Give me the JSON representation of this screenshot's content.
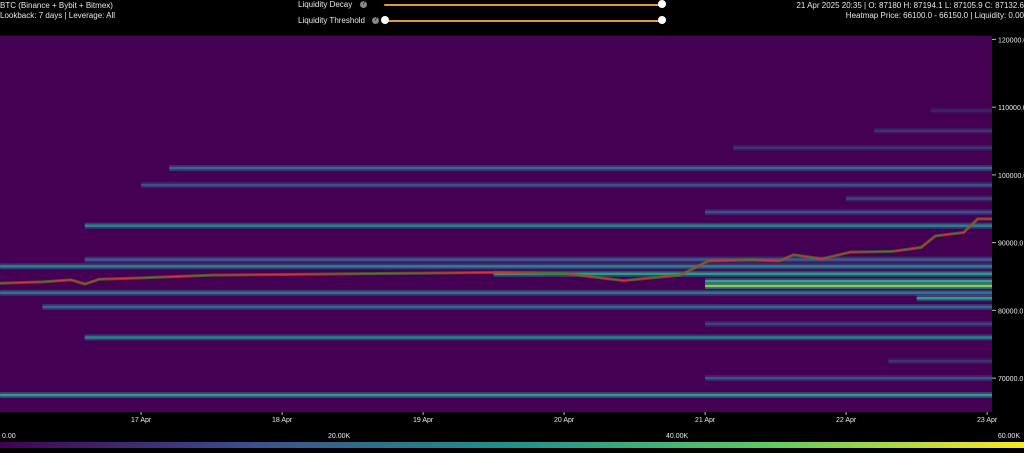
{
  "header": {
    "title": "BTC (Binance + Bybit + Bitmex)",
    "subtitle": "Lookback: 7 days | Leverage: All",
    "ohlc": "21 Apr 2025 20:35 | O: 87180 H: 87194.1 L: 87105.9 C: 87132.6",
    "heatmap_info": "Heatmap Price: 66100.0 - 66150.0 | Liquidity: 0.00",
    "sliders": [
      {
        "label": "Liquidity Decay",
        "help": "?",
        "value": 1.0
      },
      {
        "label": "Liquidity Threshold",
        "help": "?",
        "value": 0.0
      }
    ]
  },
  "colors": {
    "background": "#440154",
    "price_line": "#d4342c",
    "slider_track": "#e8963a"
  },
  "chart_data": {
    "type": "heatmap",
    "x_ticks": [
      "17 Apr",
      "18 Apr",
      "19 Apr",
      "20 Apr",
      "21 Apr",
      "22 Apr",
      "23 Apr"
    ],
    "y_ticks": [
      "120000.0",
      "110000.0",
      "100000.0",
      "90000.0",
      "80000.0",
      "70000.0"
    ],
    "ylim": [
      65000,
      120500
    ],
    "price_line": [
      [
        0,
        84000
      ],
      [
        0.3,
        84200
      ],
      [
        0.5,
        84500
      ],
      [
        0.6,
        83900
      ],
      [
        0.7,
        84600
      ],
      [
        1.0,
        84800
      ],
      [
        1.5,
        85200
      ],
      [
        2.0,
        85300
      ],
      [
        2.5,
        85400
      ],
      [
        3.0,
        85500
      ],
      [
        3.5,
        85600
      ],
      [
        4.0,
        85400
      ],
      [
        4.4,
        84400
      ],
      [
        4.8,
        85200
      ],
      [
        5.0,
        87300
      ],
      [
        5.3,
        87500
      ],
      [
        5.5,
        87300
      ],
      [
        5.6,
        88200
      ],
      [
        5.8,
        87600
      ],
      [
        6.0,
        88600
      ],
      [
        6.3,
        88700
      ],
      [
        6.5,
        89300
      ],
      [
        6.6,
        91000
      ],
      [
        6.8,
        91500
      ],
      [
        6.9,
        93500
      ],
      [
        7.0,
        93500
      ]
    ],
    "levels": [
      {
        "price": 67500,
        "start": 0.0,
        "strength": 0.55
      },
      {
        "price": 70000,
        "start": 5.0,
        "strength": 0.25
      },
      {
        "price": 72500,
        "start": 6.3,
        "strength": 0.15
      },
      {
        "price": 76000,
        "start": 0.6,
        "strength": 0.45
      },
      {
        "price": 78000,
        "start": 5.0,
        "strength": 0.2
      },
      {
        "price": 80500,
        "start": 0.3,
        "strength": 0.35
      },
      {
        "price": 81800,
        "start": 6.5,
        "strength": 0.55
      },
      {
        "price": 82600,
        "start": 0.0,
        "strength": 0.4
      },
      {
        "price": 83600,
        "start": 5.0,
        "strength": 0.8
      },
      {
        "price": 84300,
        "start": 5.0,
        "strength": 0.6
      },
      {
        "price": 85400,
        "start": 3.5,
        "strength": 0.55
      },
      {
        "price": 86500,
        "start": 0.0,
        "strength": 0.45
      },
      {
        "price": 87500,
        "start": 0.6,
        "strength": 0.3
      },
      {
        "price": 92500,
        "start": 0.6,
        "strength": 0.45
      },
      {
        "price": 94500,
        "start": 5.0,
        "strength": 0.25
      },
      {
        "price": 96500,
        "start": 6.0,
        "strength": 0.2
      },
      {
        "price": 98500,
        "start": 1.0,
        "strength": 0.25
      },
      {
        "price": 101000,
        "start": 1.2,
        "strength": 0.35
      },
      {
        "price": 104000,
        "start": 5.2,
        "strength": 0.15
      },
      {
        "price": 106500,
        "start": 6.2,
        "strength": 0.15
      },
      {
        "price": 109500,
        "start": 6.6,
        "strength": 0.1
      }
    ],
    "colorbar": {
      "ticks": [
        "0.00",
        "20.00K",
        "40.00K",
        "60.00K"
      ],
      "range": [
        0,
        60000
      ]
    }
  }
}
